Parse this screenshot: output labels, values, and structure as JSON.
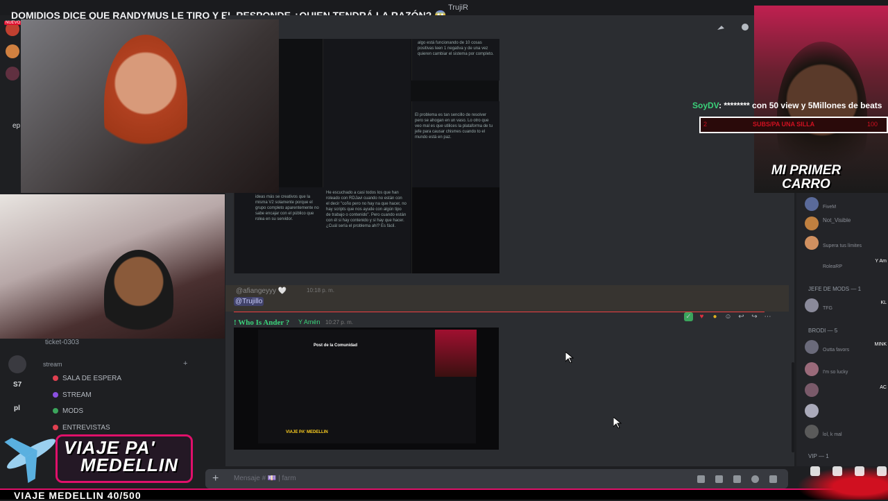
{
  "stream": {
    "title": "DOMIDIOS DICE QUE RANDYMUS LE TIRO Y EL RESPONDE ¿QUIEN TENDRÁ LA RAZÓN? 😱",
    "channel": "TrujiR",
    "new_badge": "NUEVO",
    "cam_caption_line1": "MI PRIMER",
    "cam_caption_line2": "CARRO",
    "chat_user": "SoyDV",
    "chat_text": ": ******** con 50 view y 5Millones de beats",
    "goal_label": "SUBS/PA UNA SILLA",
    "goal_mini": "2",
    "goal_count": "100",
    "badge_line1": "VIAJE PA'",
    "badge_line2": "MEDELLIN",
    "bottom_ticker": "VIAJE MEDELLIN 40/500"
  },
  "chat": {
    "msg1_author": "@afiangeyyy 🤍",
    "msg1_time": "10:18 p. m.",
    "msg1_mention": "@Trujillo",
    "msg2_author": "! Who Is Ander ?",
    "msg2_role": "Y Amén",
    "msg2_time": "10:27 p. m.",
    "shot_texts": [
      "algo está funcionando de 10 cosas positivas leen 1 negativa y de una vez quieren cambiar el sistema por completo.",
      "El problema es tan sencillo de resolver pero se ahogan en un vaso. Lo otro que veo mal es que utilices la plataforma de tu jefe para causar chismes cuando to el mundo está en paz.",
      "He escuchado a casi todos los que han roleado con RDJavi cuando no están con el decir \"coño pero no hay na que hacer, no hay scripts que nos ayude con algún tipo de trabajo o contenido\". Pero cuando están con él si hay contenido y si hay que hacer. ¿Cuál sería el problema ahí? Es fácil.",
      "ideas más se creativos que la misma V2 solamente porque el grupo completo aparentemente no sabe encajar con el público que rolea en su servidor."
    ],
    "embed_title": "Post de la Comunidad",
    "embed_caption": "VIAJE PA' MEDELLIN",
    "composer_placeholder": "Mensaje # 💷 | farm"
  },
  "sidebar": {
    "ticket": "ticket-0303",
    "stream_category": "stream",
    "channels": [
      "SALA DE ESPERA",
      "STREAM",
      "MODS",
      "ENTREVISTAS"
    ],
    "rail_labels": [
      "ep",
      "S7",
      "pl"
    ]
  },
  "members": {
    "rows": [
      {
        "name": "",
        "sub": "FiveM",
        "role": ""
      },
      {
        "name": "Not_Visible",
        "sub": "",
        "role": ""
      },
      {
        "name": "",
        "sub": "Supera tus límites",
        "role": ""
      },
      {
        "name": "",
        "sub": "RoleaRP",
        "role": "Y Am"
      }
    ],
    "section_mods": "JEFE DE MODS — 1",
    "mods_rows": [
      {
        "sub": "TFG",
        "role": "KL"
      }
    ],
    "section_brodi": "BRODI — 5",
    "brodi_rows": [
      {
        "sub": "Outta favors",
        "role": "MINK"
      },
      {
        "sub": "I'm so lucky",
        "role": ""
      },
      {
        "sub": "",
        "role": "AC"
      },
      {
        "sub": "",
        "role": ""
      },
      {
        "sub": "lol, k mal",
        "role": ""
      }
    ],
    "section_vip": "VIP — 1"
  },
  "colors": {
    "accent_pink": "#e0106a",
    "online_green": "#3ad27a",
    "divider_red": "#f23f43"
  }
}
